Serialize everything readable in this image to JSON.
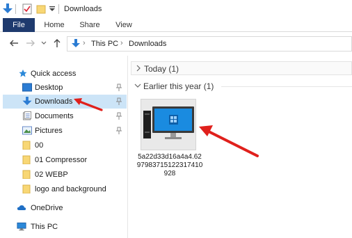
{
  "window": {
    "title": "Downloads"
  },
  "ribbon": {
    "tabs": [
      {
        "label": "File",
        "active": true
      },
      {
        "label": "Home"
      },
      {
        "label": "Share"
      },
      {
        "label": "View"
      }
    ]
  },
  "address": {
    "crumbs": [
      "This PC",
      "Downloads"
    ]
  },
  "sidebar": {
    "items": [
      {
        "label": "Quick access",
        "icon": "star-icon"
      },
      {
        "label": "Desktop",
        "icon": "desktop-folder-icon",
        "pinned": true
      },
      {
        "label": "Downloads",
        "icon": "download-arrow-icon",
        "pinned": true,
        "selected": true
      },
      {
        "label": "Documents",
        "icon": "documents-icon",
        "pinned": true
      },
      {
        "label": "Pictures",
        "icon": "pictures-icon",
        "pinned": true
      },
      {
        "label": "00",
        "icon": "folder-icon"
      },
      {
        "label": "01 Compressor",
        "icon": "folder-icon"
      },
      {
        "label": "02 WEBP",
        "icon": "folder-icon"
      },
      {
        "label": "logo and background",
        "icon": "folder-icon"
      },
      {
        "label": "OneDrive",
        "icon": "cloud-icon"
      },
      {
        "label": "This PC",
        "icon": "computer-icon"
      }
    ]
  },
  "content": {
    "groups": [
      {
        "label": "Today (1)",
        "expanded": false
      },
      {
        "label": "Earlier this year (1)",
        "expanded": true
      }
    ],
    "file": {
      "name": "5a22d33d16a4a4.6297983715122317410928"
    }
  },
  "colors": {
    "accent": "#1e3a6e",
    "selection": "#cce4f7",
    "annotation": "#e0201c",
    "folder": "#f8d775"
  }
}
